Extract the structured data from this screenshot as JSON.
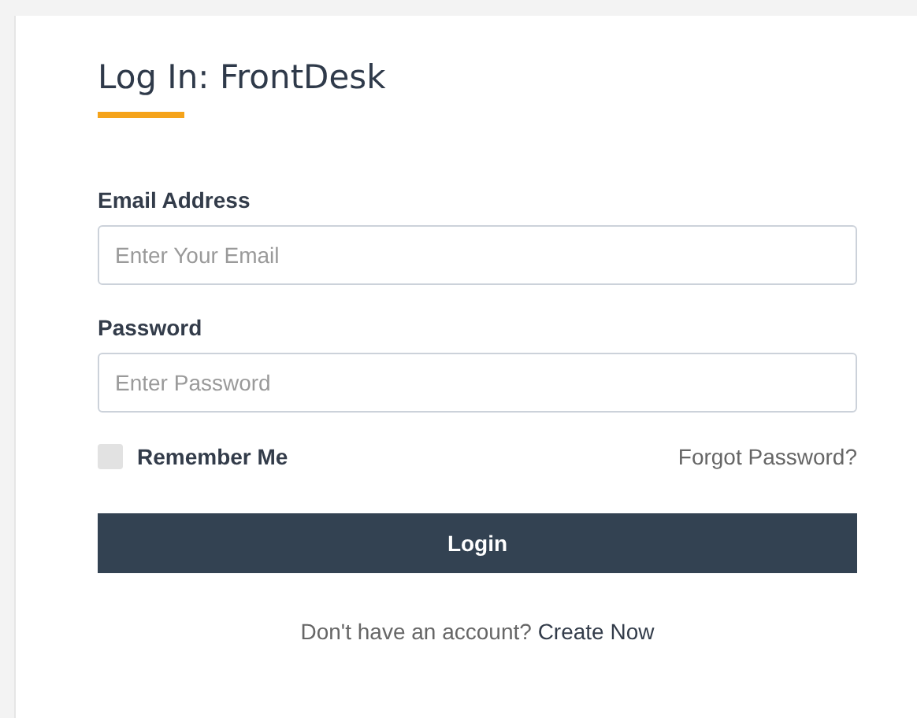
{
  "title": "Log In: FrontDesk",
  "fields": [
    {
      "label": "Email Address",
      "placeholder": "Enter Your Email"
    },
    {
      "label": "Password",
      "placeholder": "Enter Password"
    }
  ],
  "remember": {
    "label": "Remember Me",
    "checked": false
  },
  "forgot_link": "Forgot Password?",
  "submit_button": "Login",
  "footer": {
    "text": "Don't have an account?",
    "link": "Create Now"
  }
}
